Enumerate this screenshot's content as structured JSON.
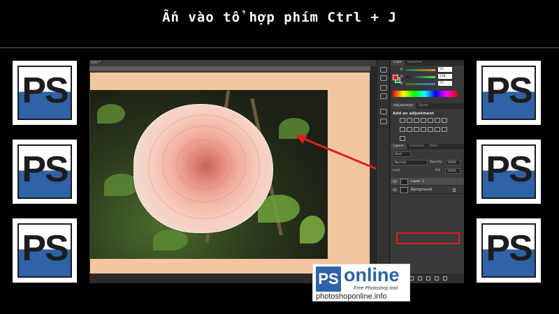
{
  "title": "Ấn vào tổ hợp phím Ctrl + J",
  "side_logos": [
    "PS",
    "PS",
    "PS",
    "PS",
    "PS",
    "PS"
  ],
  "photoshop": {
    "doc_tab": "8/8) *",
    "panels": {
      "color_tabs": [
        "Color",
        "Swatches"
      ],
      "color": {
        "r_label": "R",
        "r_value": "53",
        "g_label": "G",
        "g_value": "128",
        "b_label": "B",
        "b_value": "75",
        "foreground": "#e0201a",
        "background": "#1f9b3a"
      },
      "adjust_tabs": [
        "Adjustments",
        "Styles"
      ],
      "adjust_title": "Add an adjustment",
      "layers_tabs": [
        "Layers",
        "Channels",
        "Paths"
      ],
      "filter_kind": "Kind",
      "blend_mode": "Normal",
      "opacity_label": "Opacity:",
      "opacity_value": "100%",
      "lock_label": "Lock:",
      "fill_label": "Fill:",
      "fill_value": "100%",
      "layers": [
        {
          "name": "Layer 1",
          "selected": true
        },
        {
          "name": "Background",
          "selected": false
        }
      ]
    },
    "annotation_color": "#e0201a"
  },
  "watermark": {
    "ps": "PS",
    "brand": "online",
    "tagline": "Free Photoshop tool",
    "url": "photoshoponline.info"
  }
}
